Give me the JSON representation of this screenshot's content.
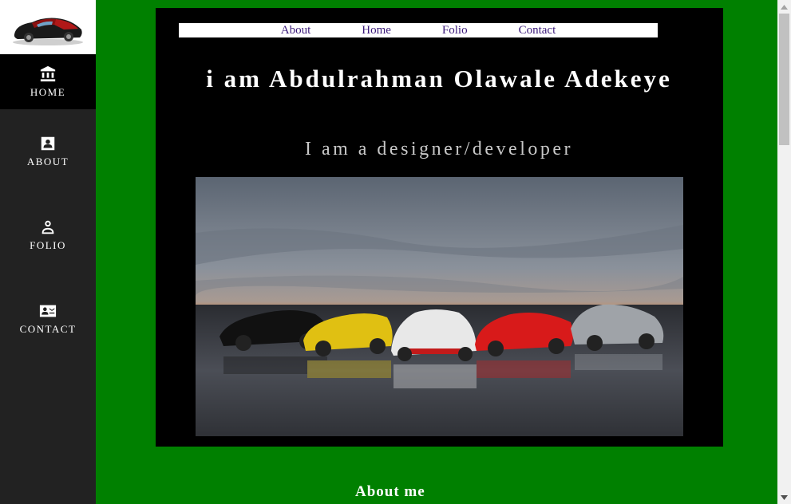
{
  "sidebar": {
    "logo": "car-logo",
    "items": [
      {
        "label": "HOME",
        "icon": "bank-icon"
      },
      {
        "label": "ABOUT",
        "icon": "contact-card-icon"
      },
      {
        "label": "FOLIO",
        "icon": "person-icon"
      },
      {
        "label": "CONTACT",
        "icon": "contact-mail-icon"
      }
    ]
  },
  "topnav": {
    "links": [
      "About",
      "Home",
      "Folio",
      "Contact"
    ]
  },
  "hero": {
    "title": "i am Abdulrahman Olawale Adekeye",
    "subtitle": "I am a designer/developer",
    "image": "five-sports-cars-photo"
  },
  "about": {
    "heading": "About me"
  },
  "colors": {
    "page_bg": "#008000",
    "sidebar_bg": "#222222",
    "panel_bg": "#000000",
    "link": "#3b1a7a"
  }
}
